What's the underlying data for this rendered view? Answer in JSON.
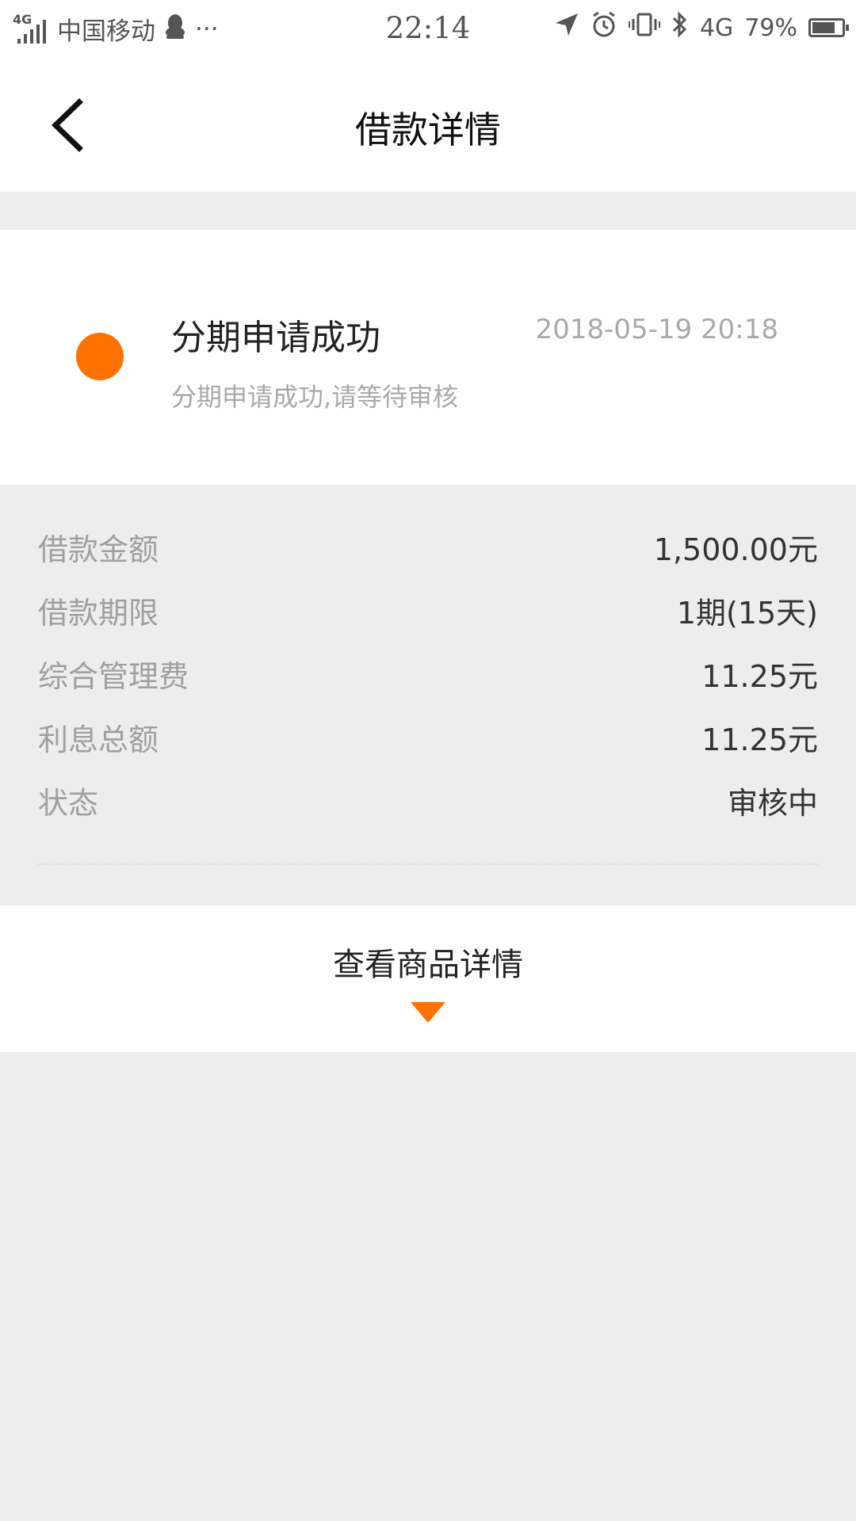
{
  "status_bar": {
    "network_tag": "4G",
    "carrier": "中国移动",
    "more": "···",
    "time": "22:14",
    "network": "4G",
    "battery_pct": "79%",
    "battery_level": 0.79
  },
  "nav": {
    "title": "借款详情"
  },
  "status_card": {
    "title": "分期申请成功",
    "time": "2018-05-19 20:18",
    "subtitle": "分期申请成功,请等待审核",
    "dot_color": "#ff7200"
  },
  "details": {
    "rows": [
      {
        "label": "借款金额",
        "value": "1,500.00元"
      },
      {
        "label": "借款期限",
        "value": "1期(15天)"
      },
      {
        "label": "综合管理费",
        "value": "11.25元"
      },
      {
        "label": "利息总额",
        "value": "11.25元"
      },
      {
        "label": "状态",
        "value": "审核中"
      }
    ]
  },
  "product": {
    "label": "查看商品详情"
  },
  "colors": {
    "accent": "#ff7200",
    "background": "#ededed"
  },
  "icons": {
    "back": "chevron-left-icon",
    "location": "location-arrow-icon",
    "alarm": "alarm-icon",
    "vibrate": "vibrate-icon",
    "bluetooth": "bluetooth-icon",
    "qq": "qq-penguin-icon",
    "expand": "triangle-down-icon"
  }
}
